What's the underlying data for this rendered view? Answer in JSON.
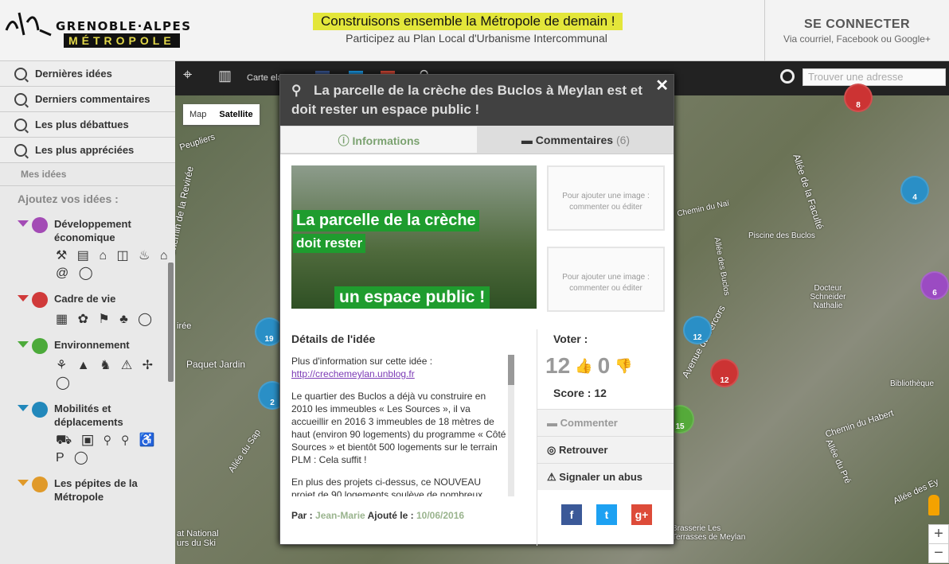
{
  "header": {
    "logo_line1": "GRENOBLE·ALPES",
    "logo_line2": "MÉTROPOLE",
    "tagline": "Construisons ensemble la Métropole de demain !",
    "subtitle": "Participez au Plan Local d'Urbanisme Intercommunal",
    "login_title": "SE CONNECTER",
    "login_sub": "Via courriel, Facebook ou Google+"
  },
  "sidebar": {
    "nav": [
      "Dernières idées",
      "Derniers commentaires",
      "Les plus débattues",
      "Les plus appréciées"
    ],
    "mes_idees": "Mes idées",
    "add_title": "Ajoutez vos idées :",
    "categories": [
      {
        "name": "Développement économique",
        "color": "#a34bb5",
        "icons": "⚒ ▤ ⌂ ◫ ♨ ⌂ @ ◯"
      },
      {
        "name": "Cadre de vie",
        "color": "#d03a3a",
        "icons": "▦ ✿ ⚑ ♣ ◯"
      },
      {
        "name": "Environnement",
        "color": "#4caa3a",
        "icons": "⚘ ▲ ♞ ⚠ ✢ ◯"
      },
      {
        "name": "Mobilités et déplacements",
        "color": "#2288bb",
        "icons": "⛟ ▣ ⚲ ⚲ ♿ P ◯"
      },
      {
        "name": "Les pépites de la Métropole",
        "color": "#e09a2a",
        "icons": ""
      }
    ]
  },
  "map": {
    "toolbar_label": "Carte ela",
    "search_placeholder": "Trouver une adresse",
    "map_btn": "Map",
    "satellite_btn": "Satellite",
    "labels": [
      "Chemin de la Revirée",
      "Paquet Jardin",
      "Allée de la Faculté",
      "Avenue du Vercors",
      "Piscine des Buclos",
      "Docteur Schneider Nathalie",
      "Bibliothèque",
      "Chemin du Habert",
      "Allée du Pré",
      "Brasserie Les Terrasses de Meylan",
      "Allée des Ey",
      "Peupliers",
      "Chemin du Naï",
      "Allée des Buclos",
      "Allée du Sap",
      "irée",
      "at National urs du Ski"
    ],
    "pins": [
      {
        "n": "8",
        "color": "#cc3333"
      },
      {
        "n": "4",
        "color": "#2a8fc6"
      },
      {
        "n": "6",
        "color": "#9b4bc2"
      },
      {
        "n": "19",
        "color": "#2a8fc6"
      },
      {
        "n": "12",
        "color": "#2a8fc6"
      },
      {
        "n": "12",
        "color": "#cc3333"
      },
      {
        "n": "15",
        "color": "#55aa3a"
      },
      {
        "n": "2",
        "color": "#2a8fc6"
      }
    ]
  },
  "modal": {
    "title": "La parcelle de la crèche des Buclos à Meylan est et doit rester un espace public !",
    "close": "✕",
    "tab_info": "Informations",
    "tab_comments": "Commentaires",
    "comments_count": "(6)",
    "photo_text1": "La parcelle de la crèche",
    "photo_text2": "doit rester",
    "photo_text3": "un espace public !",
    "placeholder": "Pour ajouter une image : commenter ou éditer",
    "details_title": "Détails de l'idée",
    "more_info": "Plus d'information sur cette idée :",
    "link": "http://crechemeylan.unblog.fr",
    "para1": "Le quartier des Buclos a déjà vu construire en 2010 les immeubles « Les Sources », il va accueillir en 2016 3 immeubles de 18 mètres de haut (environ 90 logements) du programme « Côté Sources » et bientôt 500 logements sur le terrain PLM : Cela suffit !",
    "para2": "En plus des projets ci-dessus, ce NOUVEAU projet de 90 logements soulève de nombreux",
    "par": "Par :",
    "author": "Jean-Marie",
    "added": "Ajouté le :",
    "date": "10/06/2016",
    "vote_title": "Voter :",
    "up": "12",
    "down": "0",
    "score_label": "Score :",
    "score": "12",
    "comment_btn": "Commenter",
    "locate_btn": "Retrouver",
    "report_btn": "Signaler un abus"
  }
}
